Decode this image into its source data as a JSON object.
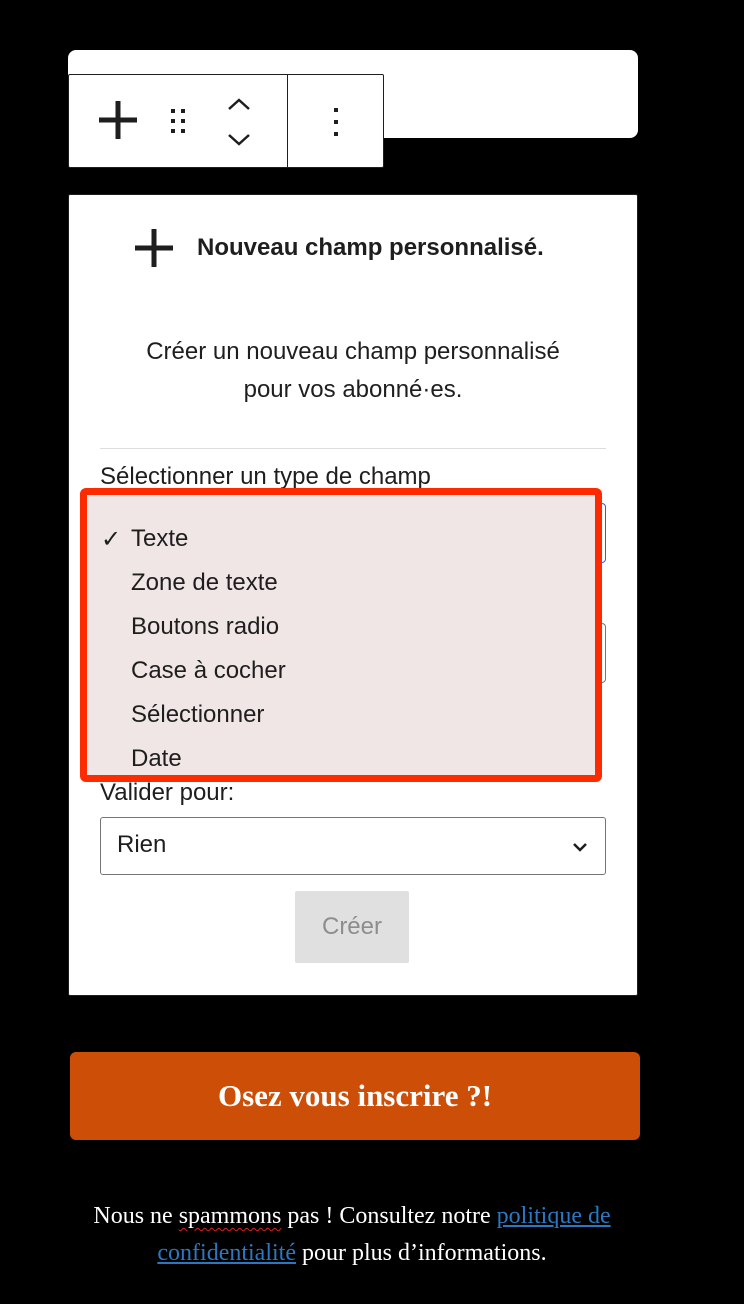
{
  "toolbar": {
    "add_icon": "plus-icon",
    "drag_icon": "drag-handle-icon",
    "move_icon": "chevron-up-down-icon",
    "more_icon": "more-vertical-icon"
  },
  "panel": {
    "icon": "plus-icon",
    "title": "Nouveau champ personnalisé.",
    "description_line1": "Créer un nouveau champ personnalisé",
    "description_line2": "pour vos abonné·es.",
    "field_type_label": "Sélectionner un type de champ",
    "field_type_options": [
      "Texte",
      "Zone de texte",
      "Boutons radio",
      "Case à cocher",
      "Sélectionner",
      "Date"
    ],
    "selected_check": "✓",
    "validate_label": "Valider pour:",
    "validate_value": "Rien",
    "create_label": "Créer"
  },
  "cta": {
    "label": "Osez vous inscrire ?!"
  },
  "footer": {
    "text_part1": "Nous ne ",
    "spelling_word": "spammons",
    "text_part2": " pas ! Consultez notre ",
    "link_line1": "politique de",
    "link_line2": "confidentialité",
    "text_part3": " pour plus d’informations."
  }
}
